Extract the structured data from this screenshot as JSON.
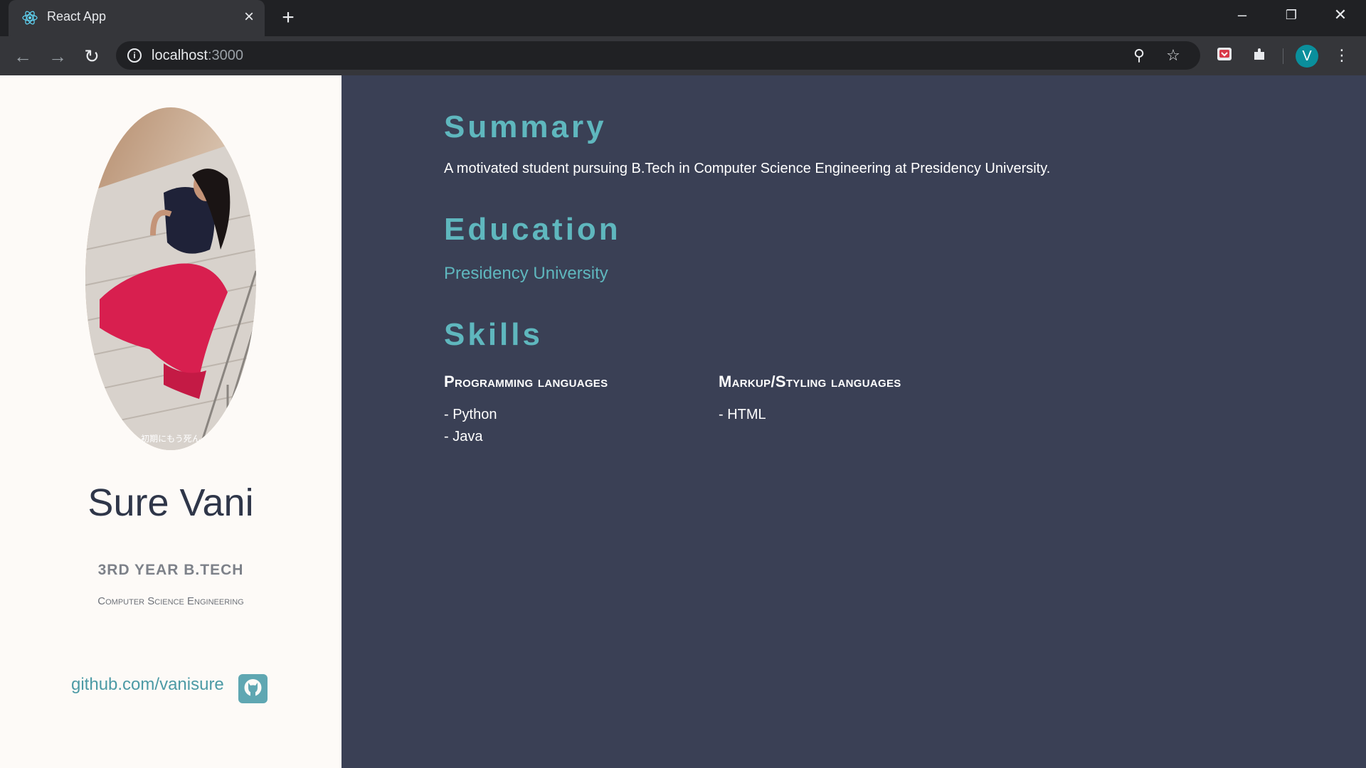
{
  "browser": {
    "tab_title": "React App",
    "url_host": "localhost",
    "url_port": ":3000",
    "avatar_letter": "V"
  },
  "sidebar": {
    "name": "Sure Vani",
    "year": "3RD YEAR B.TECH",
    "department": "Computer Science Engineering",
    "github_link": "github.com/vanisure",
    "photo_caption": "初期にもう死ん"
  },
  "main": {
    "summary_heading": "Summary",
    "summary_text": "A motivated student pursuing B.Tech in Computer Science Engineering at Presidency University.",
    "education_heading": "Education",
    "university": "Presidency University",
    "skills_heading": "Skills",
    "skill_groups": [
      {
        "title": "Programming languages",
        "items": [
          "- Python",
          "- Java"
        ]
      },
      {
        "title": "Markup/Styling languages",
        "items": [
          "- HTML"
        ]
      }
    ]
  },
  "colors": {
    "accent": "#5fb7be",
    "main_bg": "#3a4055",
    "sidebar_bg": "#fdfaf7"
  }
}
